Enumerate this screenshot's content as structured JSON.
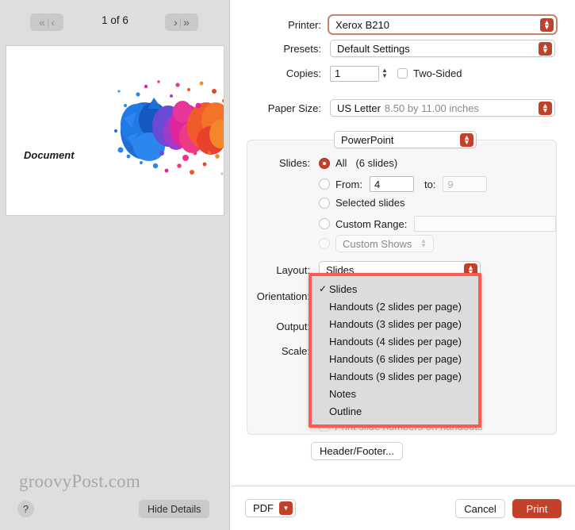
{
  "preview": {
    "nav": {
      "first_label": "«",
      "prev_label": "‹",
      "next_label": "›",
      "last_label": "»",
      "separator": "|"
    },
    "page_counter": "1 of 6",
    "document_label": "Document",
    "watermark": "groovyPost.com",
    "help_label": "?",
    "hide_details_label": "Hide Details"
  },
  "settings": {
    "printer": {
      "label": "Printer:",
      "value": "Xerox B210",
      "focused": true
    },
    "presets": {
      "label": "Presets:",
      "value": "Default Settings"
    },
    "copies": {
      "label": "Copies:",
      "value": "1"
    },
    "two_sided": {
      "label": "Two-Sided",
      "checked": false
    },
    "paper_size": {
      "label": "Paper Size:",
      "value": "US Letter",
      "detail": "8.50 by 11.00 inches"
    },
    "app_popup": {
      "value": "PowerPoint"
    },
    "slides": {
      "label": "Slides:",
      "all_label": "All",
      "all_count": "(6 slides)",
      "from_label": "From:",
      "from_value": "4",
      "to_label": "to:",
      "to_value": "9",
      "selected_label": "Selected slides",
      "custom_range_label": "Custom Range:",
      "custom_range_value": "",
      "custom_shows_label": "Custom Shows"
    },
    "layout": {
      "label": "Layout:",
      "value": "Slides"
    },
    "orientation": {
      "label": "Orientation:"
    },
    "output": {
      "label": "Output:"
    },
    "scale": {
      "label": "Scale:"
    },
    "print_slide_numbers": {
      "label": "Print slide numbers on handouts",
      "checked": false
    },
    "header_footer_label": "Header/Footer..."
  },
  "layout_menu": {
    "checkmark": "✓",
    "selected_index": 0,
    "items": [
      "Slides",
      "Handouts (2 slides per page)",
      "Handouts (3 slides per page)",
      "Handouts (4 slides per page)",
      "Handouts (6 slides per page)",
      "Handouts (9 slides per page)",
      "Notes",
      "Outline"
    ]
  },
  "footer": {
    "pdf_label": "PDF",
    "cancel_label": "Cancel",
    "print_label": "Print"
  },
  "colors": {
    "accent_red": "#c1412a",
    "highlight_red": "#ff5a52",
    "focus_ring": "#c9846e",
    "panel_bg": "#f7f7f7",
    "preview_bg": "#dedede"
  }
}
